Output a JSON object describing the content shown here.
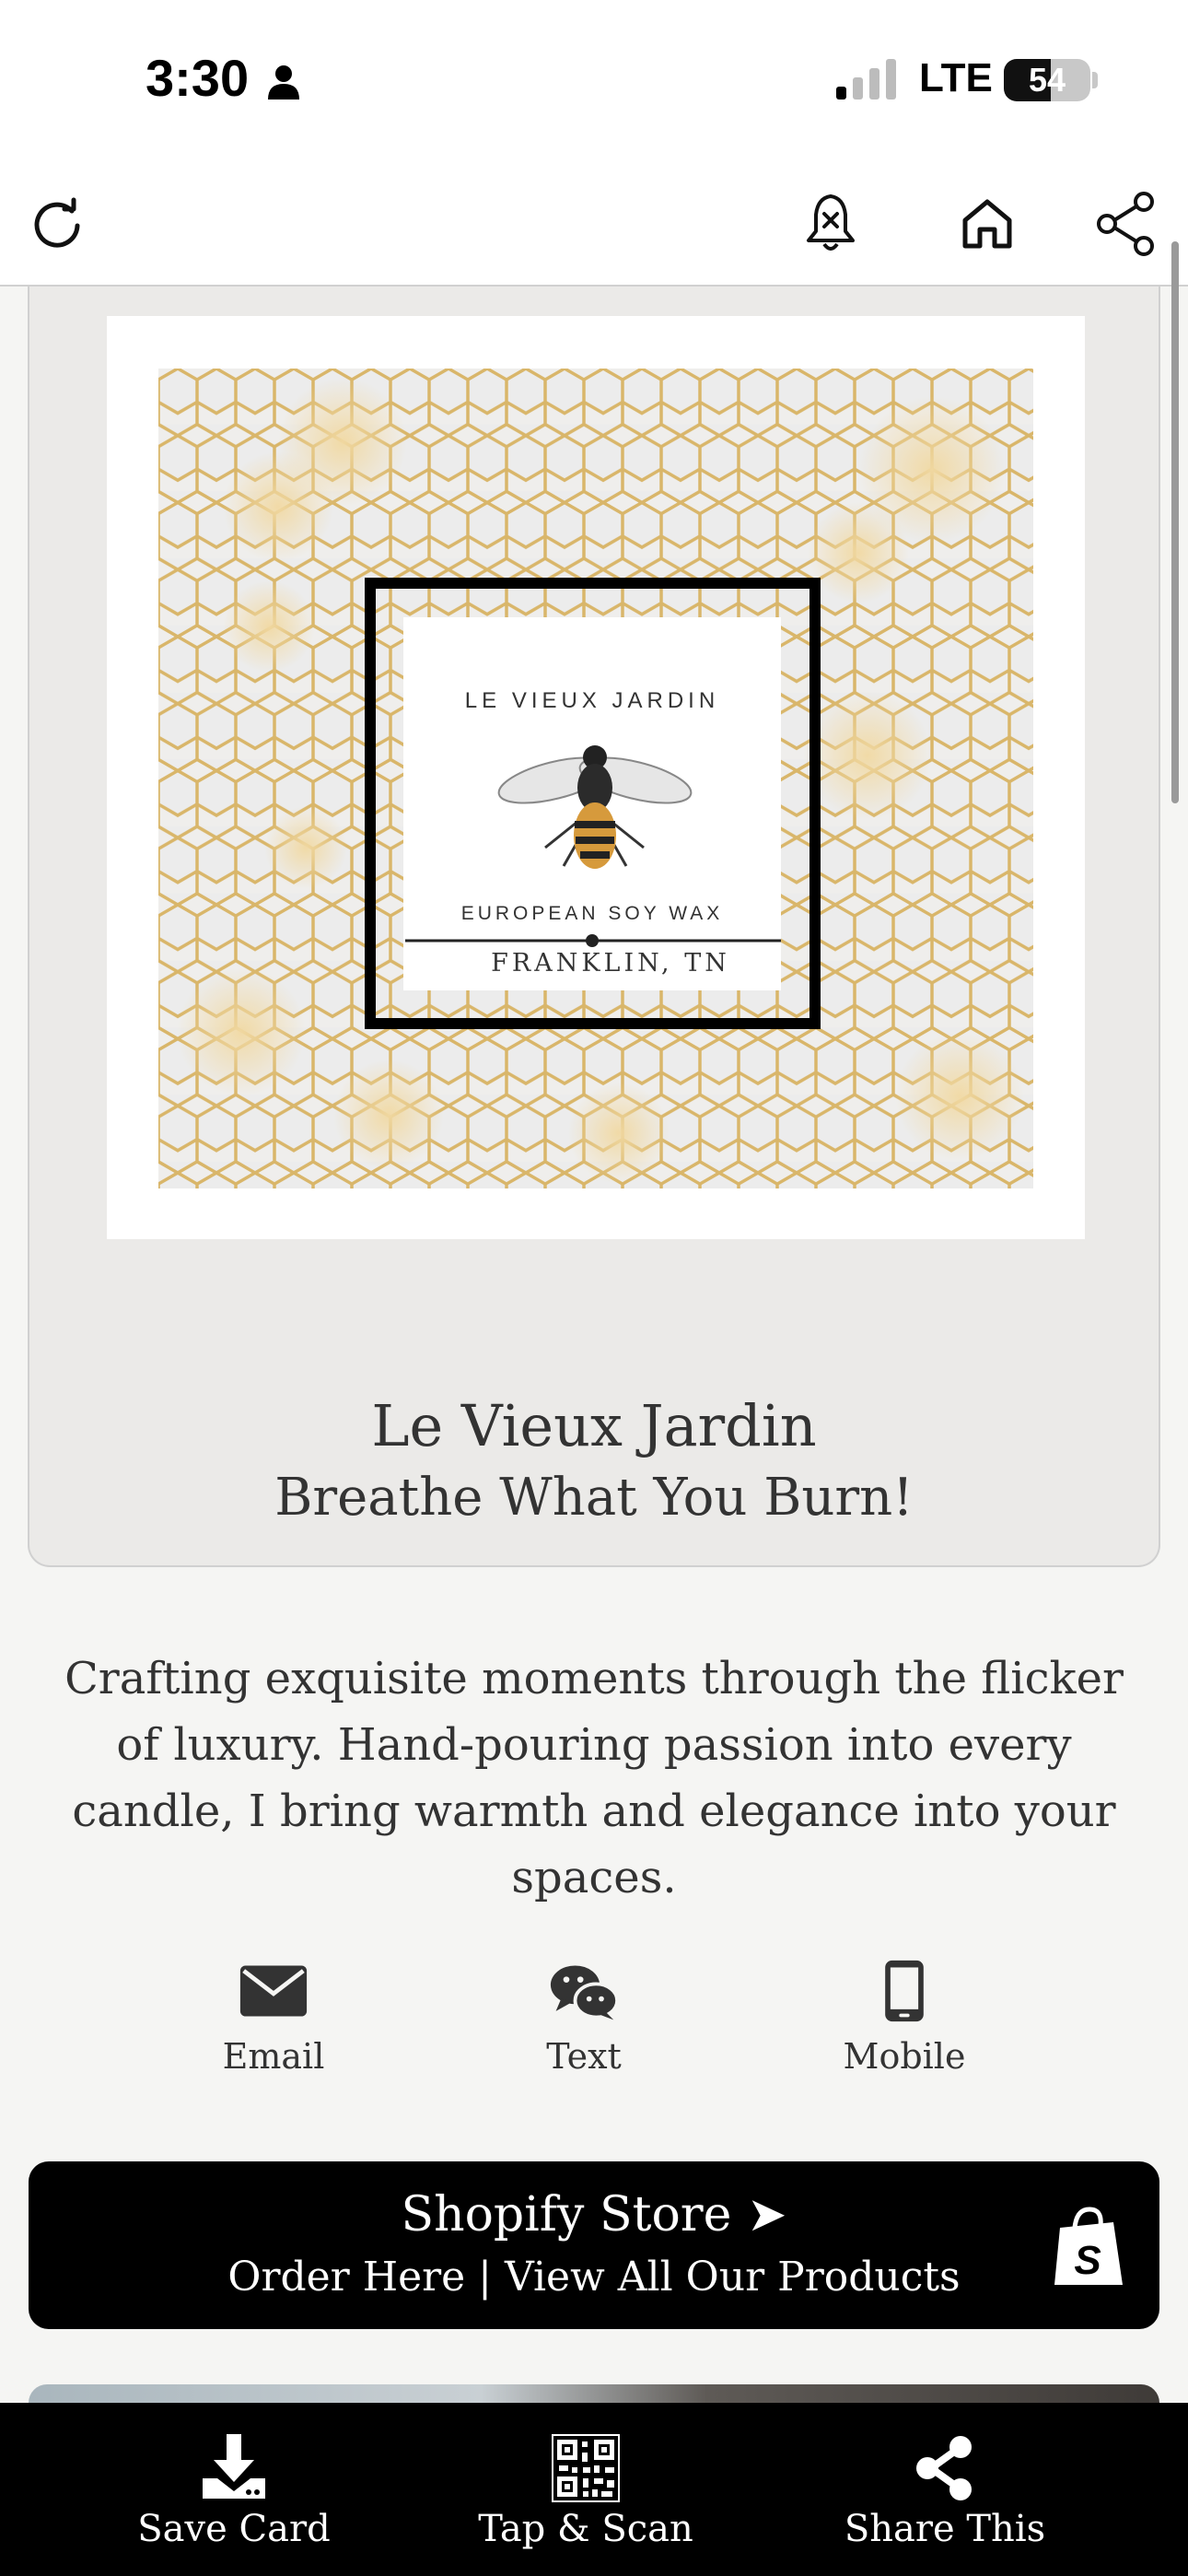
{
  "status_bar": {
    "time": "3:30",
    "network": "LTE",
    "battery_percent": 54,
    "battery_label": "54"
  },
  "toolbar": {
    "icons": [
      "refresh-icon",
      "bell-off-icon",
      "home-icon",
      "share-icon"
    ]
  },
  "hero": {
    "title": "Le Vieux Jardin",
    "subtitle": "Breathe What You Burn!",
    "logo": {
      "brand": "LE VIEUX JARDIN",
      "tagline": "EUROPEAN SOY WAX",
      "location": "FRANKLIN, TN"
    }
  },
  "bio": "Crafting exquisite moments through the flicker of luxury. Hand-pouring passion into every candle, I bring warmth and elegance into your spaces.",
  "contact": {
    "email_label": "Email",
    "text_label": "Text",
    "mobile_label": "Mobile"
  },
  "shopify": {
    "title": "Shopify Store ➤",
    "subtitle": "Order Here | View All Our Products"
  },
  "bottom_bar": {
    "save_label": "Save Card",
    "scan_label": "Tap & Scan",
    "share_label": "Share This"
  },
  "colors": {
    "accent_dark": "#000000",
    "card_bg": "#ebeae8",
    "page_bg": "#f5f5f3",
    "honeycomb_gold": "#d9b66a"
  }
}
